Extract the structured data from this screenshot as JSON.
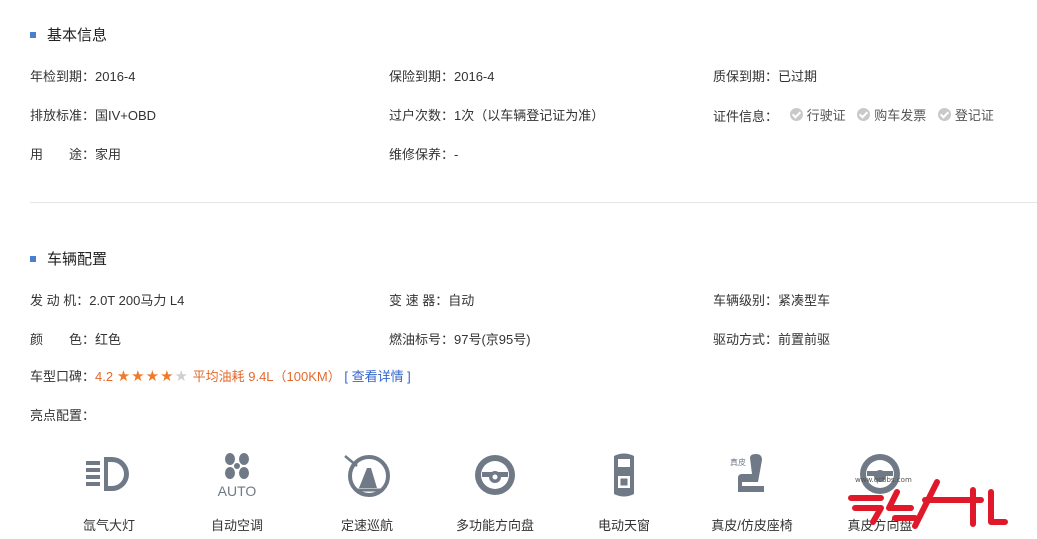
{
  "basic": {
    "title": "基本信息",
    "row1": {
      "inspect_label": "年检到期：",
      "inspect_value": "2016-4",
      "insurance_label": "保险到期：",
      "insurance_value": "2016-4",
      "warranty_label": "质保到期：",
      "warranty_value": "已过期"
    },
    "row2": {
      "emission_label": "排放标准：",
      "emission_value": "国IV+OBD",
      "transfer_label": "过户次数：",
      "transfer_value": "1次（以车辆登记证为准）",
      "docs_label": "证件信息：",
      "docs": [
        "行驶证",
        "购车发票",
        "登记证"
      ]
    },
    "row3": {
      "use_label": "用　　途：",
      "use_value": "家用",
      "maint_label": "维修保养：",
      "maint_value": "-"
    }
  },
  "config": {
    "title": "车辆配置",
    "row1": {
      "engine_label": "发 动 机：",
      "engine_value": "2.0T 200马力 L4",
      "gear_label": "变 速 器：",
      "gear_value": "自动",
      "level_label": "车辆级别：",
      "level_value": "紧凑型车"
    },
    "row2": {
      "color_label": "颜　　色：",
      "color_value": "红色",
      "fuel_label": "燃油标号：",
      "fuel_value": "97号(京95号)",
      "drive_label": "驱动方式：",
      "drive_value": "前置前驱"
    },
    "rating": {
      "label": "车型口碑：",
      "score": "4.2",
      "stars_full": 4,
      "stars_total": 5,
      "fuel_text": "平均油耗 9.4L（100KM）",
      "link": "[ 查看详情 ]"
    },
    "highlight_label": "亮点配置：",
    "features": [
      {
        "icon": "xenon-headlight-icon",
        "name": "氙气大灯"
      },
      {
        "icon": "auto-ac-icon",
        "name": "自动空调",
        "icon_text": "AUTO"
      },
      {
        "icon": "cruise-control-icon",
        "name": "定速巡航"
      },
      {
        "icon": "multifunction-wheel-icon",
        "name": "多功能方向盘"
      },
      {
        "icon": "power-sunroof-icon",
        "name": "电动天窗"
      },
      {
        "icon": "leather-seat-icon",
        "name": "真皮/仿皮座椅",
        "icon_text": "真皮"
      },
      {
        "icon": "leather-wheel-icon",
        "name": "真皮方向盘"
      }
    ]
  },
  "watermark": {
    "url_text": "www.qcbbs.com"
  },
  "colors": {
    "accent": "#4a7fd0",
    "orange": "#e26a2c",
    "link": "#3366cc",
    "icon": "#6f7a86"
  }
}
